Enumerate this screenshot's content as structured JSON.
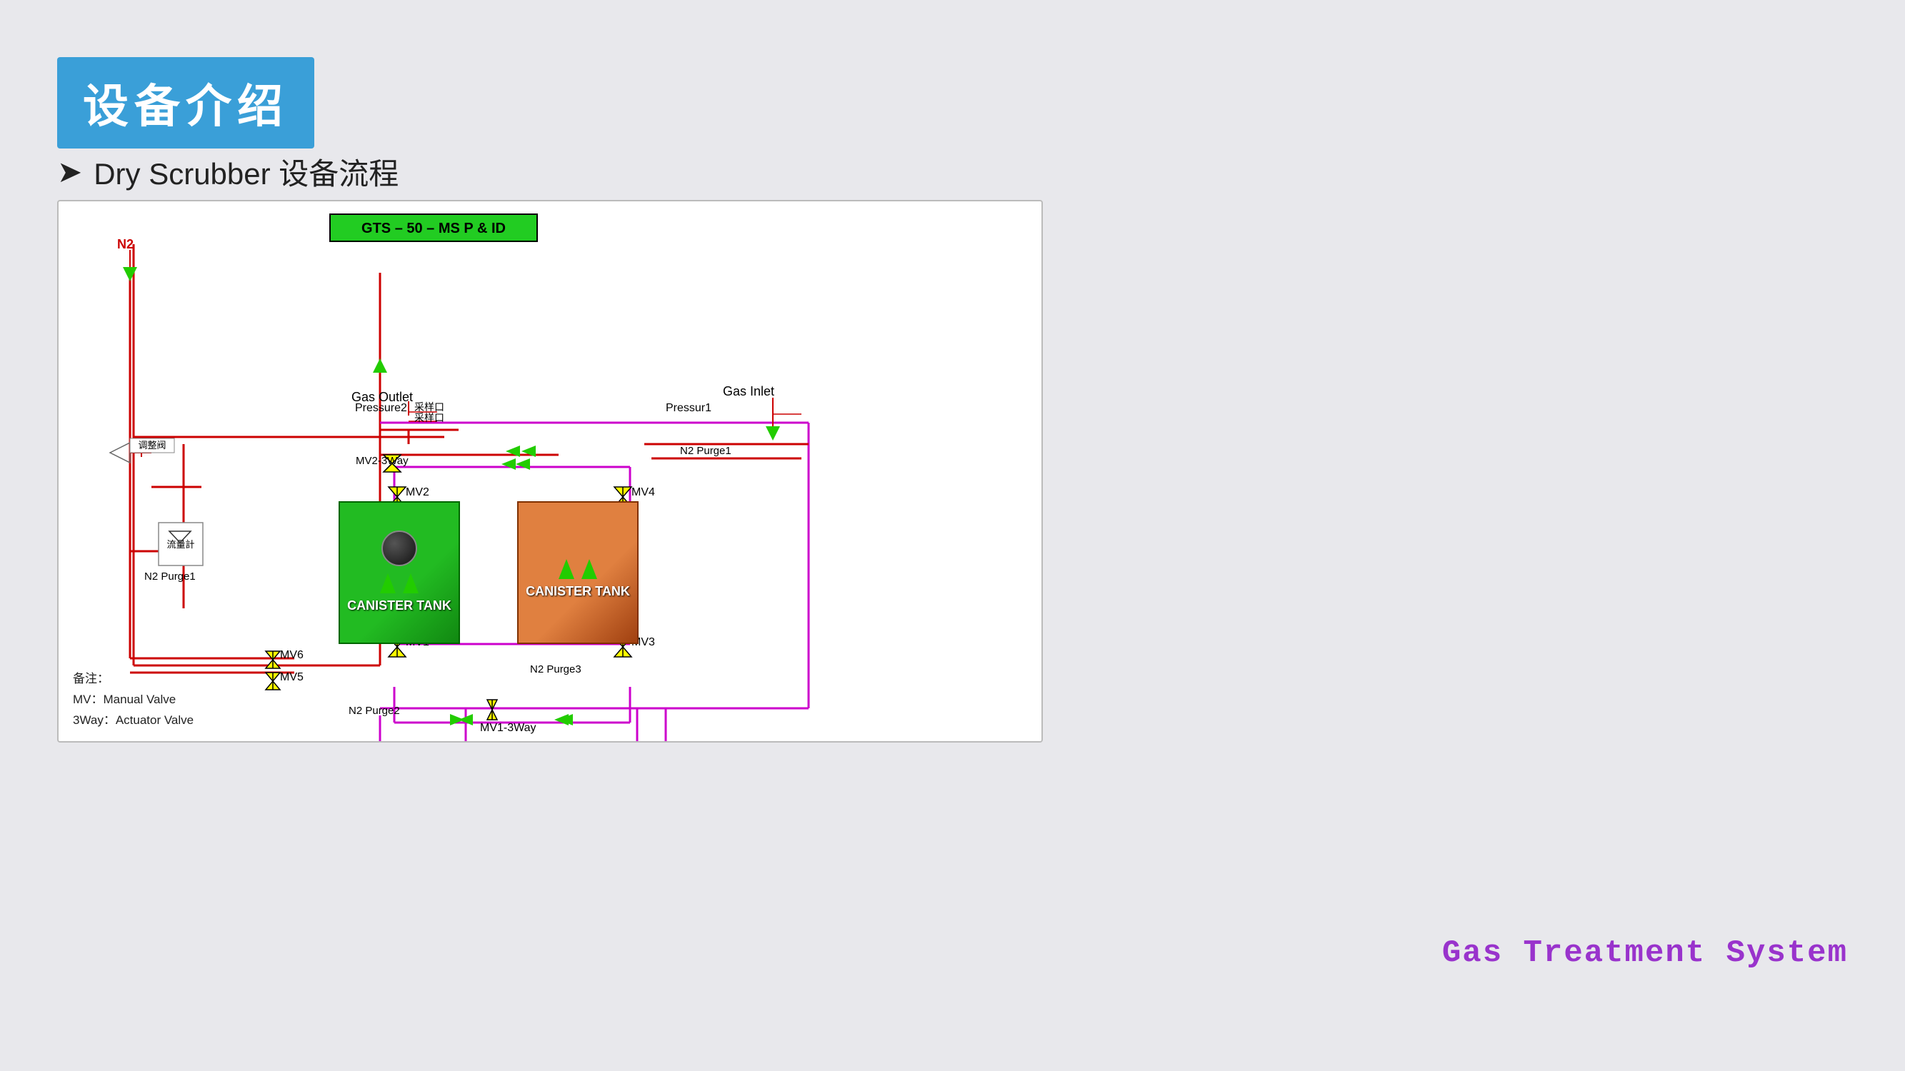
{
  "page": {
    "title": "设备介绍",
    "subtitle_arrow": "➤",
    "subtitle_text": "Dry Scrubber 设备流程"
  },
  "diagram": {
    "gts_label": "GTS – 50 – MS  P & ID",
    "gas_outlet": "Gas Outlet",
    "gas_inlet": "Gas Inlet",
    "n2_label": "N2",
    "labels": {
      "pressure2": "Pressure2",
      "pressure1": "Pressur1",
      "n2_purge1_top": "N2 Purge1",
      "n2_purge1_left": "N2 Purge1",
      "n2_purge2": "N2 Purge2",
      "n2_purge3": "N2 Purge3",
      "mv2_3way": "MV2-3Way",
      "mv1_3way": "MV1-3Way",
      "mv1": "MV1",
      "mv2": "MV2",
      "mv3": "MV3",
      "mv4": "MV4",
      "mv5": "MV5",
      "mv6": "MV6",
      "sample1": "采样口",
      "sample2": "采样口",
      "flow_meter": "流量計",
      "adjust": "调整阀",
      "canister1": "CANISTER\nTANK",
      "canister2": "CANISTER\nTANK"
    }
  },
  "gas_treatment": "Gas Treatment System",
  "notes": {
    "line1": "MV：Manual Valve",
    "line2": "3Way：Actuator Valve"
  },
  "remarks": "备注："
}
